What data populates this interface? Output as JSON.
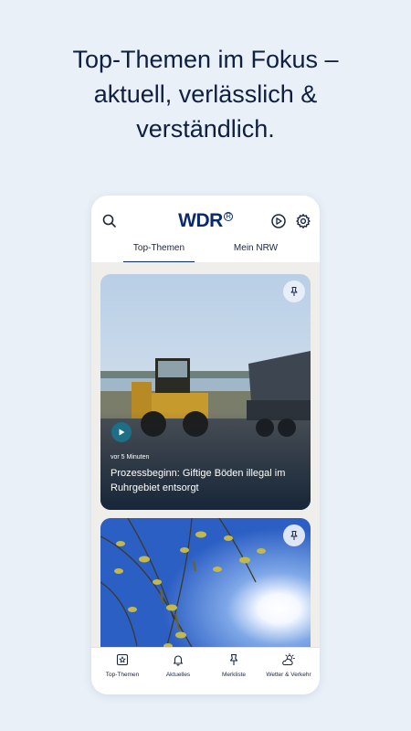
{
  "headline": {
    "line1": "Top-Themen im Fokus –",
    "line2": "aktuell, verlässlich &",
    "line3": "verständlich."
  },
  "app": {
    "logo_text": "WDR",
    "logo_mark": "R",
    "header_icons": [
      "search-icon",
      "play-circle-icon",
      "gear-icon"
    ],
    "tabs": [
      {
        "label": "Top-Themen",
        "active": true
      },
      {
        "label": "Mein NRW",
        "active": false
      }
    ],
    "articles": [
      {
        "time": "vor 5 Minuten",
        "title": "Prozessbeginn: Giftige Böden illegal im Ruhrgebiet entsorgt",
        "has_video": true
      },
      {
        "time": "",
        "title": "",
        "has_video": false
      }
    ],
    "bottom_nav": [
      {
        "label": "Top-Themen",
        "icon": "star-frame-icon",
        "active": true
      },
      {
        "label": "Aktuelles",
        "icon": "bell-icon",
        "active": false
      },
      {
        "label": "Merkliste",
        "icon": "pin-icon",
        "active": false
      },
      {
        "label": "Wetter & Verkehr",
        "icon": "weather-icon",
        "active": false
      }
    ],
    "colors": {
      "brand": "#0a2a6b",
      "background": "#e9f0f8",
      "feed_background": "#efeeea",
      "play_button": "#1c6f86"
    }
  }
}
